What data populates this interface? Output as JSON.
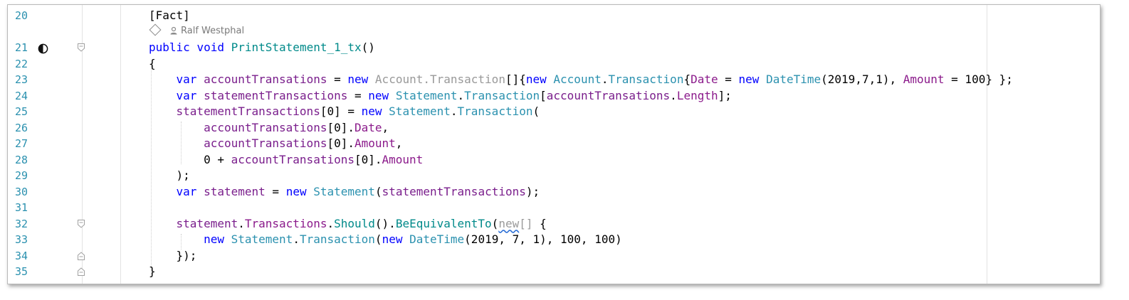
{
  "editor": {
    "colors": {
      "keyword": "#0000ff",
      "type": "#2b91af",
      "local": "#7a1e8c",
      "method": "#008a8a",
      "line_number": "#2b91af"
    },
    "codelens": {
      "author": "Ralf Westphal"
    },
    "lines": [
      {
        "n": "20",
        "tokens": [
          [
            "pl",
            "[Fact]"
          ]
        ]
      },
      {
        "n": "21",
        "tokens": [
          [
            "kw",
            "public"
          ],
          [
            "pl",
            " "
          ],
          [
            "kw",
            "void"
          ],
          [
            "pl",
            " "
          ],
          [
            "mt",
            "PrintStatement_1_tx"
          ],
          [
            "pl",
            "()"
          ]
        ]
      },
      {
        "n": "22",
        "tokens": [
          [
            "pl",
            "{"
          ]
        ]
      },
      {
        "n": "23",
        "tokens": [
          [
            "pl",
            "    "
          ],
          [
            "kw",
            "var"
          ],
          [
            "pl",
            " "
          ],
          [
            "lv",
            "accountTransations"
          ],
          [
            "pl",
            " = "
          ],
          [
            "kw",
            "new"
          ],
          [
            "pl",
            " "
          ],
          [
            "ty-g",
            "Account.Transaction"
          ],
          [
            "pl",
            "[]{"
          ],
          [
            "kw",
            "new"
          ],
          [
            "pl",
            " "
          ],
          [
            "ty",
            "Account"
          ],
          [
            "pl",
            "."
          ],
          [
            "ty",
            "Transaction"
          ],
          [
            "pl",
            "{"
          ],
          [
            "pr",
            "Date"
          ],
          [
            "pl",
            " = "
          ],
          [
            "kw",
            "new"
          ],
          [
            "pl",
            " "
          ],
          [
            "ty",
            "DateTime"
          ],
          [
            "pl",
            "(2019,7,1), "
          ],
          [
            "pr",
            "Amount"
          ],
          [
            "pl",
            " = 100} };"
          ]
        ]
      },
      {
        "n": "24",
        "tokens": [
          [
            "pl",
            "    "
          ],
          [
            "kw",
            "var"
          ],
          [
            "pl",
            " "
          ],
          [
            "lv",
            "statementTransactions"
          ],
          [
            "pl",
            " = "
          ],
          [
            "kw",
            "new"
          ],
          [
            "pl",
            " "
          ],
          [
            "ty",
            "Statement"
          ],
          [
            "pl",
            "."
          ],
          [
            "ty",
            "Transaction"
          ],
          [
            "pl",
            "["
          ],
          [
            "lv",
            "accountTransations"
          ],
          [
            "pl",
            "."
          ],
          [
            "pr",
            "Length"
          ],
          [
            "pl",
            "];"
          ]
        ]
      },
      {
        "n": "25",
        "tokens": [
          [
            "pl",
            "    "
          ],
          [
            "lv",
            "statementTransactions"
          ],
          [
            "pl",
            "[0] = "
          ],
          [
            "kw",
            "new"
          ],
          [
            "pl",
            " "
          ],
          [
            "ty",
            "Statement"
          ],
          [
            "pl",
            "."
          ],
          [
            "ty",
            "Transaction"
          ],
          [
            "pl",
            "("
          ]
        ]
      },
      {
        "n": "26",
        "tokens": [
          [
            "pl",
            "        "
          ],
          [
            "lv",
            "accountTransations"
          ],
          [
            "pl",
            "[0]."
          ],
          [
            "pr",
            "Date"
          ],
          [
            "pl",
            ","
          ]
        ]
      },
      {
        "n": "27",
        "tokens": [
          [
            "pl",
            "        "
          ],
          [
            "lv",
            "accountTransations"
          ],
          [
            "pl",
            "[0]."
          ],
          [
            "pr",
            "Amount"
          ],
          [
            "pl",
            ","
          ]
        ]
      },
      {
        "n": "28",
        "tokens": [
          [
            "pl",
            "        0 + "
          ],
          [
            "lv",
            "accountTransations"
          ],
          [
            "pl",
            "[0]."
          ],
          [
            "pr",
            "Amount"
          ]
        ]
      },
      {
        "n": "29",
        "tokens": [
          [
            "pl",
            "    );"
          ]
        ]
      },
      {
        "n": "30",
        "tokens": [
          [
            "pl",
            "    "
          ],
          [
            "kw",
            "var"
          ],
          [
            "pl",
            " "
          ],
          [
            "lv",
            "statement"
          ],
          [
            "pl",
            " = "
          ],
          [
            "kw",
            "new"
          ],
          [
            "pl",
            " "
          ],
          [
            "ty",
            "Statement"
          ],
          [
            "pl",
            "("
          ],
          [
            "lv",
            "statementTransactions"
          ],
          [
            "pl",
            ");"
          ]
        ]
      },
      {
        "n": "31",
        "tokens": []
      },
      {
        "n": "32",
        "tokens": [
          [
            "pl",
            "    "
          ],
          [
            "lv",
            "statement"
          ],
          [
            "pl",
            "."
          ],
          [
            "pr",
            "Transactions"
          ],
          [
            "pl",
            "."
          ],
          [
            "mt",
            "Should"
          ],
          [
            "pl",
            "()."
          ],
          [
            "mt",
            "BeEquivalentTo"
          ],
          [
            "pl",
            "("
          ],
          [
            "gr squig",
            "new"
          ],
          [
            "gr",
            "[]"
          ],
          [
            "pl",
            " {"
          ]
        ]
      },
      {
        "n": "33",
        "tokens": [
          [
            "pl",
            "        "
          ],
          [
            "kw",
            "new"
          ],
          [
            "pl",
            " "
          ],
          [
            "ty",
            "Statement"
          ],
          [
            "pl",
            "."
          ],
          [
            "ty",
            "Transaction"
          ],
          [
            "pl",
            "("
          ],
          [
            "kw",
            "new"
          ],
          [
            "pl",
            " "
          ],
          [
            "ty",
            "DateTime"
          ],
          [
            "pl",
            "(2019, 7, 1), 100, 100)"
          ]
        ]
      },
      {
        "n": "34",
        "tokens": [
          [
            "pl",
            "    });"
          ]
        ]
      },
      {
        "n": "35",
        "tokens": [
          [
            "pl",
            "}"
          ]
        ]
      }
    ]
  }
}
